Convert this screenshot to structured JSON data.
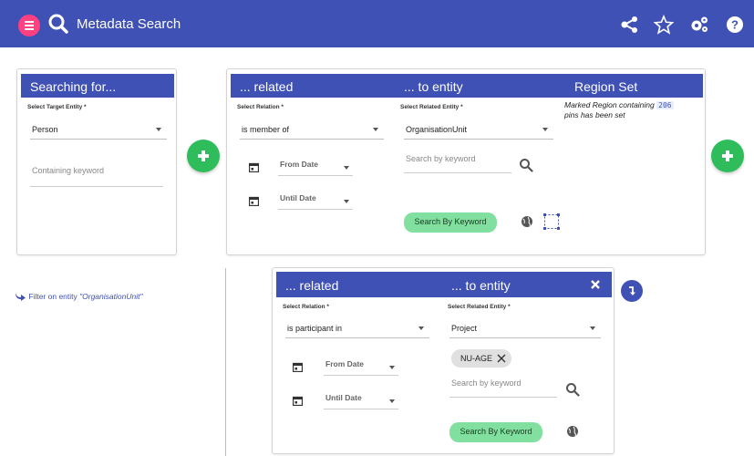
{
  "app": {
    "title": "Metadata Search",
    "icons": [
      "menu-icon",
      "search-icon",
      "share-icon",
      "star-icon",
      "settings-icon",
      "help-icon"
    ]
  },
  "colors": {
    "primary": "#3f51b5",
    "accent": "#ff4081",
    "add": "#2ebd5a",
    "search_btn": "#81e0a0"
  },
  "target_card": {
    "header": "Searching for...",
    "entity_label": "Select Target Entity *",
    "entity_value": "Person",
    "keyword_placeholder": "Containing keyword"
  },
  "relation_card_1": {
    "header_related": "... related",
    "header_entity": "... to entity",
    "header_region": "Region Set",
    "relation_label": "Select Relation *",
    "relation_value": "is member of",
    "entity_label": "Select Related Entity *",
    "entity_value": "OrganisationUnit",
    "from_date": "From Date",
    "until_date": "Until Date",
    "keyword_placeholder": "Search by keyword",
    "search_button": "Search By Keyword",
    "region_note_pre": "Marked Region containing",
    "region_count": "206",
    "region_note_post": "pins has been set"
  },
  "filter_link": {
    "prefix": "Filter on entity ",
    "entity": "\"OrganisationUnit\""
  },
  "relation_card_2": {
    "header_related": "... related",
    "header_entity": "... to entity",
    "relation_label": "Select Relation *",
    "relation_value": "is participant in",
    "entity_label": "Select Related Entity *",
    "entity_value": "Project",
    "chip": "NU-AGE",
    "from_date": "From Date",
    "until_date": "Until Date",
    "keyword_placeholder": "Search by keyword",
    "search_button": "Search By Keyword"
  }
}
